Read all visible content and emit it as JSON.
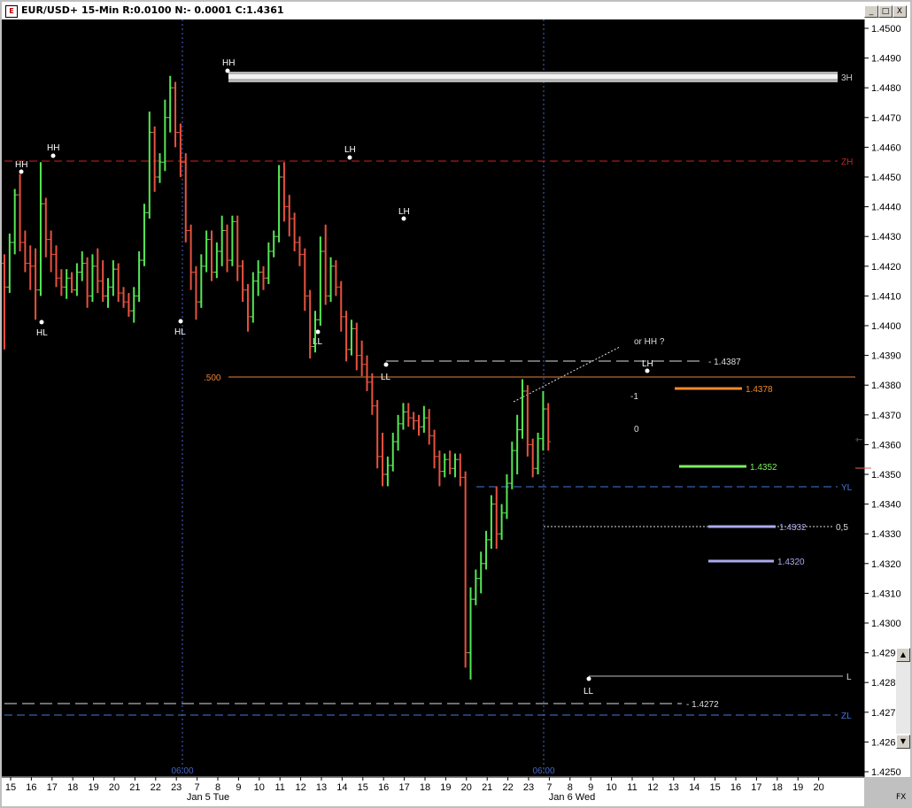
{
  "window": {
    "title": "EUR/USD+ 15-Min R:0.0100 N:- 0.0001 C:1.4361",
    "icon": "chart-app-icon",
    "buttons": [
      "_",
      "□",
      "X"
    ]
  },
  "colors": {
    "background": "#000000",
    "bull": "#55e855",
    "bear": "#e8523f",
    "orange": "#f08a2a",
    "green_level": "#7bef5e",
    "lavender": "#aaaaee",
    "blue": "#4477dd",
    "red_dash": "#cc2222",
    "grid": "#4466cc"
  },
  "chart_data": {
    "type": "ohlc",
    "symbol": "EUR/USD+",
    "timeframe": "15-Min",
    "ylim": [
      1.425,
      1.45
    ],
    "y_ticks": [
      "1.4500",
      "1.4490",
      "1.4480",
      "1.4470",
      "1.4460",
      "1.4450",
      "1.4440",
      "1.4430",
      "1.4420",
      "1.4410",
      "1.4400",
      "1.4390",
      "1.4380",
      "1.4370",
      "1.4360",
      "1.4350",
      "1.4340",
      "1.4330",
      "1.4320",
      "1.4310",
      "1.4300",
      "1.4290",
      "1.4280",
      "1.4270",
      "1.4260",
      "1.4250"
    ],
    "x_ticks": [
      "15",
      "16",
      "17",
      "18",
      "19",
      "20",
      "21",
      "22",
      "23",
      "7",
      "8",
      "9",
      "10",
      "11",
      "12",
      "13",
      "14",
      "15",
      "16",
      "17",
      "18",
      "19",
      "20",
      "21",
      "22",
      "23",
      "7",
      "8",
      "9",
      "10",
      "11",
      "12",
      "13",
      "14",
      "15",
      "16",
      "17",
      "18",
      "19",
      "20"
    ],
    "date_labels": [
      "Jan 5 Tue",
      "Jan 6 Wed"
    ],
    "session_labels": [
      "06:00",
      "06:00"
    ],
    "corner_label": "FX",
    "current_price": 1.4361,
    "bars": [
      {
        "o": 1.4421,
        "h": 1.4424,
        "l": 1.4392,
        "c": 1.4413
      },
      {
        "o": 1.4413,
        "h": 1.4431,
        "l": 1.4411,
        "c": 1.4428
      },
      {
        "o": 1.4428,
        "h": 1.4446,
        "l": 1.4424,
        "c": 1.4444
      },
      {
        "o": 1.4444,
        "h": 1.4451,
        "l": 1.4425,
        "c": 1.4428
      },
      {
        "o": 1.4428,
        "h": 1.4432,
        "l": 1.4418,
        "c": 1.4421
      },
      {
        "o": 1.4421,
        "h": 1.4427,
        "l": 1.4412,
        "c": 1.442
      },
      {
        "o": 1.442,
        "h": 1.4426,
        "l": 1.4402,
        "c": 1.4412
      },
      {
        "o": 1.4412,
        "h": 1.4455,
        "l": 1.441,
        "c": 1.4441
      },
      {
        "o": 1.4441,
        "h": 1.4443,
        "l": 1.4423,
        "c": 1.4429
      },
      {
        "o": 1.4429,
        "h": 1.4432,
        "l": 1.4418,
        "c": 1.4424
      },
      {
        "o": 1.4424,
        "h": 1.4427,
        "l": 1.4413,
        "c": 1.4416
      },
      {
        "o": 1.4416,
        "h": 1.4419,
        "l": 1.441,
        "c": 1.4413
      },
      {
        "o": 1.4413,
        "h": 1.4419,
        "l": 1.4409,
        "c": 1.4416
      },
      {
        "o": 1.4416,
        "h": 1.4418,
        "l": 1.4411,
        "c": 1.4412
      },
      {
        "o": 1.4412,
        "h": 1.4421,
        "l": 1.441,
        "c": 1.4418
      },
      {
        "o": 1.4418,
        "h": 1.4425,
        "l": 1.4415,
        "c": 1.4421
      },
      {
        "o": 1.4421,
        "h": 1.4423,
        "l": 1.4406,
        "c": 1.441
      },
      {
        "o": 1.441,
        "h": 1.4424,
        "l": 1.4408,
        "c": 1.442
      },
      {
        "o": 1.442,
        "h": 1.4426,
        "l": 1.4411,
        "c": 1.4415
      },
      {
        "o": 1.4415,
        "h": 1.4422,
        "l": 1.4408,
        "c": 1.441
      },
      {
        "o": 1.441,
        "h": 1.4416,
        "l": 1.4406,
        "c": 1.4413
      },
      {
        "o": 1.4413,
        "h": 1.4422,
        "l": 1.441,
        "c": 1.4419
      },
      {
        "o": 1.4419,
        "h": 1.4421,
        "l": 1.4408,
        "c": 1.4411
      },
      {
        "o": 1.4411,
        "h": 1.4413,
        "l": 1.4406,
        "c": 1.4408
      },
      {
        "o": 1.4408,
        "h": 1.4411,
        "l": 1.4403,
        "c": 1.4405
      },
      {
        "o": 1.4405,
        "h": 1.4413,
        "l": 1.4401,
        "c": 1.441
      },
      {
        "o": 1.441,
        "h": 1.4425,
        "l": 1.4408,
        "c": 1.4422
      },
      {
        "o": 1.4422,
        "h": 1.4441,
        "l": 1.442,
        "c": 1.4438
      },
      {
        "o": 1.4438,
        "h": 1.4472,
        "l": 1.4436,
        "c": 1.4465
      },
      {
        "o": 1.4465,
        "h": 1.4467,
        "l": 1.4445,
        "c": 1.445
      },
      {
        "o": 1.445,
        "h": 1.4458,
        "l": 1.4448,
        "c": 1.4455
      },
      {
        "o": 1.4455,
        "h": 1.4476,
        "l": 1.4452,
        "c": 1.447
      },
      {
        "o": 1.447,
        "h": 1.4484,
        "l": 1.4465,
        "c": 1.448
      },
      {
        "o": 1.448,
        "h": 1.4482,
        "l": 1.446,
        "c": 1.4465
      },
      {
        "o": 1.4465,
        "h": 1.4468,
        "l": 1.445,
        "c": 1.4455
      },
      {
        "o": 1.4455,
        "h": 1.4458,
        "l": 1.4428,
        "c": 1.4432
      },
      {
        "o": 1.4432,
        "h": 1.4434,
        "l": 1.4412,
        "c": 1.4418
      },
      {
        "o": 1.4418,
        "h": 1.442,
        "l": 1.4402,
        "c": 1.4408
      },
      {
        "o": 1.4408,
        "h": 1.4424,
        "l": 1.4406,
        "c": 1.442
      },
      {
        "o": 1.442,
        "h": 1.4432,
        "l": 1.4418,
        "c": 1.4429
      },
      {
        "o": 1.4429,
        "h": 1.4432,
        "l": 1.4415,
        "c": 1.4418
      },
      {
        "o": 1.4418,
        "h": 1.4428,
        "l": 1.4416,
        "c": 1.4425
      },
      {
        "o": 1.4425,
        "h": 1.4437,
        "l": 1.442,
        "c": 1.4432
      },
      {
        "o": 1.4432,
        "h": 1.4434,
        "l": 1.4418,
        "c": 1.4422
      },
      {
        "o": 1.4422,
        "h": 1.4437,
        "l": 1.442,
        "c": 1.4435
      },
      {
        "o": 1.4435,
        "h": 1.4437,
        "l": 1.4415,
        "c": 1.442
      },
      {
        "o": 1.442,
        "h": 1.4422,
        "l": 1.4408,
        "c": 1.4412
      },
      {
        "o": 1.4412,
        "h": 1.4414,
        "l": 1.4398,
        "c": 1.4403
      },
      {
        "o": 1.4403,
        "h": 1.4418,
        "l": 1.4401,
        "c": 1.4415
      },
      {
        "o": 1.4415,
        "h": 1.4422,
        "l": 1.441,
        "c": 1.4418
      },
      {
        "o": 1.4418,
        "h": 1.442,
        "l": 1.4412,
        "c": 1.4416
      },
      {
        "o": 1.4416,
        "h": 1.4428,
        "l": 1.4414,
        "c": 1.4425
      },
      {
        "o": 1.4425,
        "h": 1.4432,
        "l": 1.4423,
        "c": 1.443
      },
      {
        "o": 1.443,
        "h": 1.4454,
        "l": 1.4428,
        "c": 1.445
      },
      {
        "o": 1.445,
        "h": 1.4455,
        "l": 1.4435,
        "c": 1.444
      },
      {
        "o": 1.444,
        "h": 1.4444,
        "l": 1.443,
        "c": 1.4436
      },
      {
        "o": 1.4436,
        "h": 1.4438,
        "l": 1.4425,
        "c": 1.4428
      },
      {
        "o": 1.4428,
        "h": 1.443,
        "l": 1.442,
        "c": 1.4424
      },
      {
        "o": 1.4424,
        "h": 1.4426,
        "l": 1.4405,
        "c": 1.441
      },
      {
        "o": 1.441,
        "h": 1.4412,
        "l": 1.4389,
        "c": 1.4393
      },
      {
        "o": 1.4393,
        "h": 1.4405,
        "l": 1.4391,
        "c": 1.4402
      },
      {
        "o": 1.4402,
        "h": 1.443,
        "l": 1.44,
        "c": 1.4425
      },
      {
        "o": 1.4425,
        "h": 1.4434,
        "l": 1.4407,
        "c": 1.441
      },
      {
        "o": 1.441,
        "h": 1.4423,
        "l": 1.4408,
        "c": 1.442
      },
      {
        "o": 1.442,
        "h": 1.4422,
        "l": 1.441,
        "c": 1.4413
      },
      {
        "o": 1.4413,
        "h": 1.4415,
        "l": 1.4398,
        "c": 1.4403
      },
      {
        "o": 1.4403,
        "h": 1.4405,
        "l": 1.4388,
        "c": 1.4392
      },
      {
        "o": 1.4392,
        "h": 1.4402,
        "l": 1.439,
        "c": 1.4399
      },
      {
        "o": 1.4399,
        "h": 1.4401,
        "l": 1.4385,
        "c": 1.439
      },
      {
        "o": 1.439,
        "h": 1.4395,
        "l": 1.4383,
        "c": 1.4387
      },
      {
        "o": 1.4387,
        "h": 1.439,
        "l": 1.4378,
        "c": 1.4381
      },
      {
        "o": 1.4381,
        "h": 1.4384,
        "l": 1.437,
        "c": 1.4373
      },
      {
        "o": 1.4373,
        "h": 1.4375,
        "l": 1.4352,
        "c": 1.4356
      },
      {
        "o": 1.4356,
        "h": 1.4364,
        "l": 1.4346,
        "c": 1.435
      },
      {
        "o": 1.435,
        "h": 1.4356,
        "l": 1.4346,
        "c": 1.4353
      },
      {
        "o": 1.4353,
        "h": 1.4364,
        "l": 1.4351,
        "c": 1.4361
      },
      {
        "o": 1.4361,
        "h": 1.437,
        "l": 1.4358,
        "c": 1.4367
      },
      {
        "o": 1.4367,
        "h": 1.4374,
        "l": 1.4365,
        "c": 1.4371
      },
      {
        "o": 1.4371,
        "h": 1.4374,
        "l": 1.4366,
        "c": 1.4369
      },
      {
        "o": 1.4369,
        "h": 1.4371,
        "l": 1.4365,
        "c": 1.4368
      },
      {
        "o": 1.4368,
        "h": 1.437,
        "l": 1.4363,
        "c": 1.4366
      },
      {
        "o": 1.4366,
        "h": 1.4373,
        "l": 1.4364,
        "c": 1.4369
      },
      {
        "o": 1.4369,
        "h": 1.4372,
        "l": 1.436,
        "c": 1.4363
      },
      {
        "o": 1.4363,
        "h": 1.4365,
        "l": 1.4352,
        "c": 1.4356
      },
      {
        "o": 1.4356,
        "h": 1.4358,
        "l": 1.4346,
        "c": 1.4351
      },
      {
        "o": 1.4351,
        "h": 1.4357,
        "l": 1.4349,
        "c": 1.4355
      },
      {
        "o": 1.4355,
        "h": 1.4358,
        "l": 1.435,
        "c": 1.4352
      },
      {
        "o": 1.4352,
        "h": 1.4357,
        "l": 1.4349,
        "c": 1.4355
      },
      {
        "o": 1.4355,
        "h": 1.4357,
        "l": 1.4346,
        "c": 1.4349
      },
      {
        "o": 1.4349,
        "h": 1.4351,
        "l": 1.4285,
        "c": 1.429
      },
      {
        "o": 1.429,
        "h": 1.4312,
        "l": 1.4281,
        "c": 1.4308
      },
      {
        "o": 1.4308,
        "h": 1.4318,
        "l": 1.4306,
        "c": 1.4315
      },
      {
        "o": 1.4315,
        "h": 1.4324,
        "l": 1.431,
        "c": 1.432
      },
      {
        "o": 1.432,
        "h": 1.4331,
        "l": 1.4318,
        "c": 1.4328
      },
      {
        "o": 1.4328,
        "h": 1.4343,
        "l": 1.4325,
        "c": 1.434
      },
      {
        "o": 1.434,
        "h": 1.4346,
        "l": 1.4325,
        "c": 1.433
      },
      {
        "o": 1.433,
        "h": 1.434,
        "l": 1.4328,
        "c": 1.4337
      },
      {
        "o": 1.4337,
        "h": 1.435,
        "l": 1.4335,
        "c": 1.4347
      },
      {
        "o": 1.4347,
        "h": 1.4361,
        "l": 1.4345,
        "c": 1.4358
      },
      {
        "o": 1.4358,
        "h": 1.437,
        "l": 1.435,
        "c": 1.4365
      },
      {
        "o": 1.4365,
        "h": 1.4382,
        "l": 1.4362,
        "c": 1.4378
      },
      {
        "o": 1.4378,
        "h": 1.438,
        "l": 1.4356,
        "c": 1.436
      },
      {
        "o": 1.436,
        "h": 1.4362,
        "l": 1.4349,
        "c": 1.4352
      },
      {
        "o": 1.4352,
        "h": 1.4364,
        "l": 1.435,
        "c": 1.4362
      },
      {
        "o": 1.4362,
        "h": 1.4378,
        "l": 1.4358,
        "c": 1.4372
      },
      {
        "o": 1.4372,
        "h": 1.4374,
        "l": 1.4358,
        "c": 1.4361
      }
    ],
    "pivot_labels": [
      "HH",
      "HH",
      "HL",
      "HL",
      "HH",
      "LL",
      "LH",
      "LH",
      "LL",
      "LH",
      "LL"
    ],
    "level_labels": {
      "three_h": "3H",
      "zh": "ZH",
      "yl": "YL",
      "l": "L",
      "zl": "ZL",
      "half": ".500",
      "half_right": "0,5",
      "p4387": "- 1.4387",
      "p4378": "1.4378",
      "p4352": "1.4352",
      "p4332": "1.4332",
      "p4320": "1.4320",
      "p4272": "- 1.4272",
      "minus1": "-1",
      "zero": "0",
      "or_hh": "or HH ?"
    }
  }
}
